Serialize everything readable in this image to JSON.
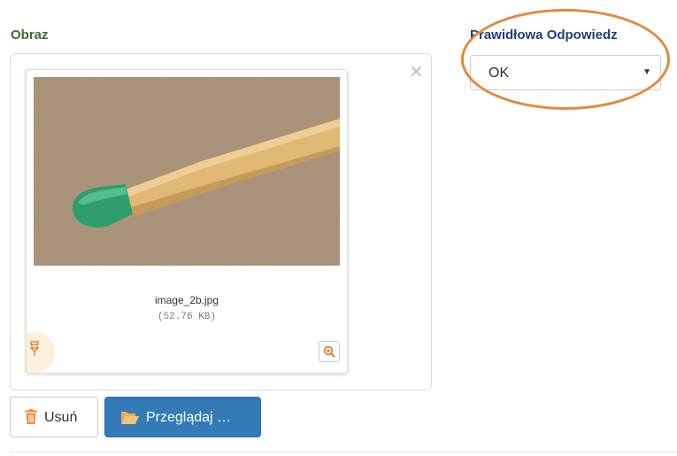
{
  "image_section": {
    "label": "Obraz"
  },
  "answer_section": {
    "label": "Prawidłowa Odpowiedz",
    "selected": "OK"
  },
  "file": {
    "name": "image_2b.jpg",
    "size": "(52.76 KB)"
  },
  "buttons": {
    "remove_label": "Usuń",
    "browse_label": "Przeglądaj …"
  },
  "icons": {
    "close": "close-icon",
    "drag": "drag-handle-icon",
    "zoom": "zoom-in-icon",
    "trash": "trash-icon",
    "folder": "folder-open-icon"
  },
  "colors": {
    "image_label": "#3c6b2f",
    "answer_label": "#1f3f7a",
    "highlight": "#e38a3c",
    "primary_button": "#337ab7",
    "trash_icon": "#e8914b",
    "folder_icon": "#f0ad4e"
  }
}
